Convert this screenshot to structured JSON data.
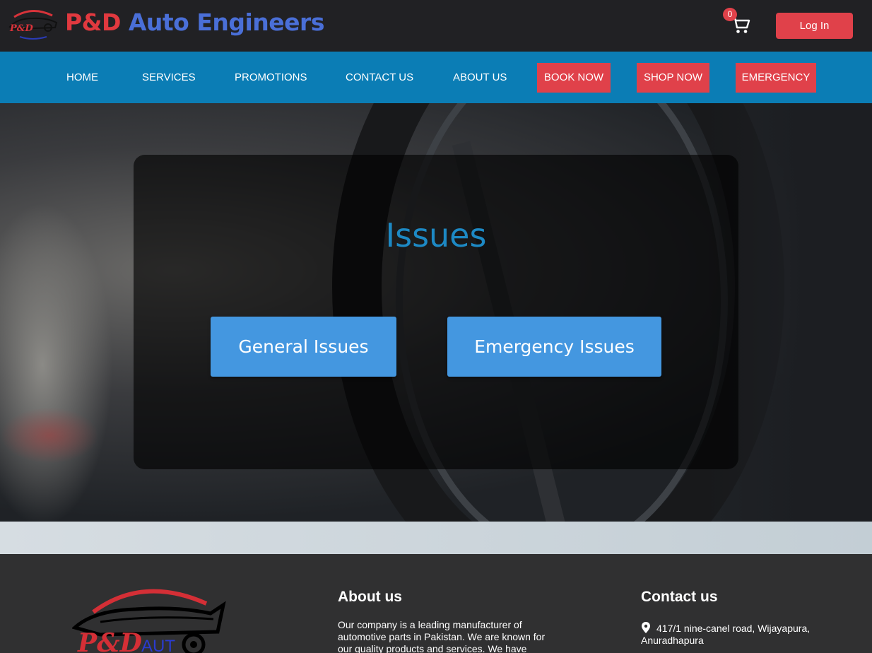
{
  "header": {
    "brand_part1": "P&D",
    "brand_part2": "Auto Engineers",
    "logo_text": "P&D",
    "cart_count": "0",
    "login_label": "Log In"
  },
  "nav": {
    "items": [
      "HOME",
      "SERVICES",
      "PROMOTIONS",
      "CONTACT US",
      "ABOUT US"
    ],
    "buttons": [
      "BOOK NOW",
      "SHOP NOW",
      "EMERGENCY"
    ]
  },
  "hero": {
    "title": "Issues",
    "general_label": "General Issues",
    "emergency_label": "Emergency Issues"
  },
  "footer": {
    "logo_text": "P&D",
    "logo_suffix": "AUT",
    "about_title": "About us",
    "about_text": "Our company is a leading manufacturer of automotive parts in Pakistan. We are known for our quality products and services. We have",
    "contact_title": "Contact us",
    "address": "417/1 nine-canel road, Wijayapura, Anuradhapura"
  },
  "colors": {
    "accent_red": "#e0414a",
    "nav_blue": "#0b7db5",
    "issue_button_blue": "#4497e0",
    "title_blue": "#1d89c4"
  },
  "icons": {
    "cart": "shopping-cart-icon",
    "location": "map-pin-icon"
  }
}
